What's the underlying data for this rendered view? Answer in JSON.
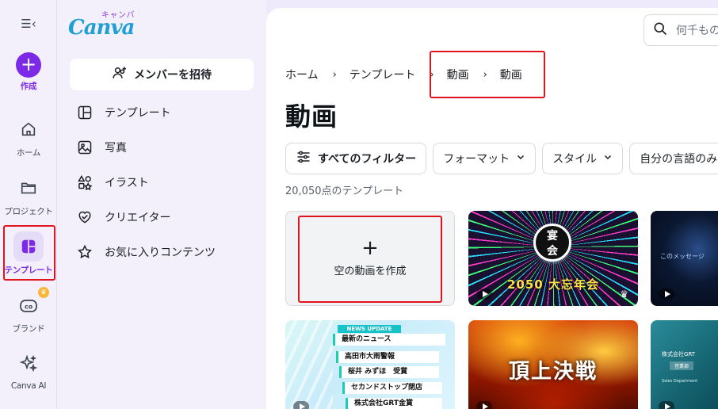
{
  "rail": {
    "toggle_glyph": "☰‹",
    "items": [
      {
        "label": "作成"
      },
      {
        "label": "ホーム"
      },
      {
        "label": "プロジェクト"
      },
      {
        "label": "テンプレート"
      },
      {
        "label": "ブランド"
      },
      {
        "label": "Canva AI"
      }
    ]
  },
  "panel": {
    "logo_text": "Canva",
    "logo_kana": "キャンバ",
    "invite_label": "メンバーを招待",
    "items": [
      {
        "label": "テンプレート"
      },
      {
        "label": "写真"
      },
      {
        "label": "イラスト"
      },
      {
        "label": "クリエイター"
      },
      {
        "label": "お気に入りコンテンツ"
      }
    ]
  },
  "main": {
    "search_placeholder": "何千もの",
    "breadcrumb": [
      "ホーム",
      "テンプレート",
      "動画",
      "動画"
    ],
    "title": "動画",
    "filters": [
      "すべてのフィルター",
      "フォーマット",
      "スタイル",
      "自分の言語のみ"
    ],
    "count_text": "20,050点のテンプレート",
    "blank_card_label": "空の動画を作成",
    "templates": {
      "enkai_badge": "宴\n会",
      "enkai_title": "2050 大忘年会",
      "dark_text": "このメッセージ",
      "news_header": "NEWS UPDATE",
      "news_lines": [
        "最新のニュース",
        "高田市大雨警報",
        "桜井 みずほ　受賞",
        "セカンドストップ閉店",
        "株式会社GRT金賞"
      ],
      "fire_title": "頂上決戦",
      "biz_company": "株式会社GRT",
      "biz_dept": "営業部",
      "biz_sub": "Sales Department"
    }
  },
  "colors": {
    "accent": "#7d2ae8",
    "highlight_box": "#e0141e"
  }
}
